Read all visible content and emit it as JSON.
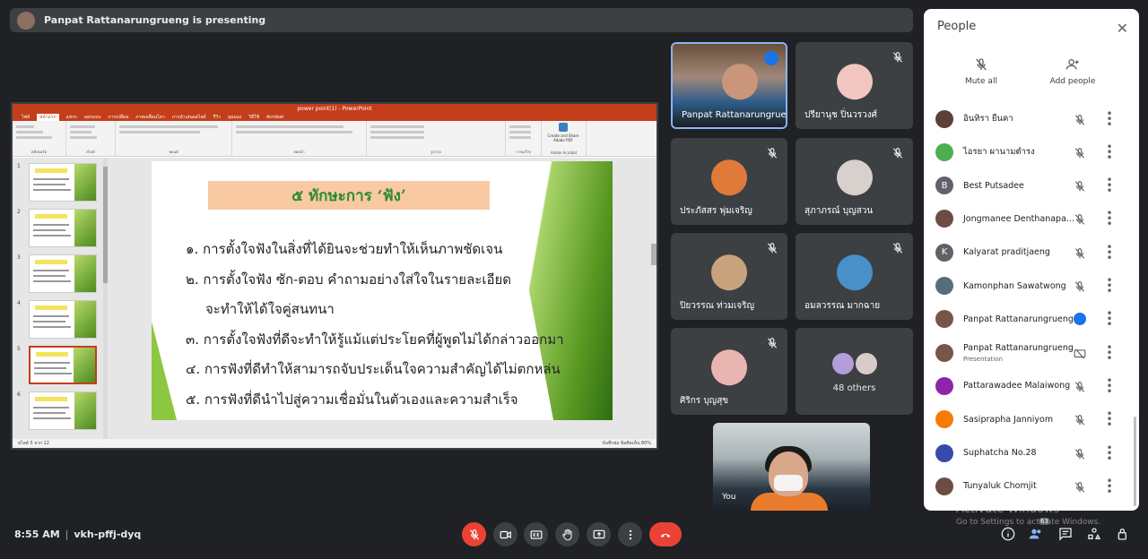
{
  "banner": {
    "text": "Panpat Rattanarungrueng is presenting"
  },
  "ppt": {
    "window_title": "power point(1) - PowerPoint",
    "tabs": [
      "ไฟล์",
      "หน้าแรก",
      "แทรก",
      "ออกแบบ",
      "การเปลี่ยน",
      "ภาพเคลื่อนไหว",
      "การนำเสนอสไลด์",
      "รีวิว",
      "มุมมอง",
      "วิธีใช้",
      "Acrobat"
    ],
    "ribbon_groups": [
      "คลิปบอร์ด",
      "สไลด์",
      "ฟอนต์",
      "ย่อหน้า",
      "รูปวาด",
      "การแก้ไข",
      "Adobe Acrobat"
    ],
    "adobe_button": "Create and Share Adobe PDF",
    "thumbnails": [
      "1",
      "2",
      "3",
      "4",
      "5",
      "6"
    ],
    "selected_slide": 5,
    "status_left": "สไลด์ 5 จาก 12",
    "status_right": "บันทึกย่อ   ข้อคิดเห็น   80%",
    "zoom_percent": 80,
    "slide": {
      "title": "๕ ทักษะการ ‘ฟัง’",
      "lines": [
        "๑. การตั้งใจฟังในสิ่งที่ได้ยินจะช่วยทำให้เห็นภาพชัดเจน",
        "๒. การตั้งใจฟัง ซัก-ตอบ คำถามอย่างใส่ใจในรายละเอียด",
        "จะทำให้ได้ใจคู่สนทนา",
        "๓. การตั้งใจฟังที่ดีจะทำให้รู้แม้แต่ประโยคที่ผู้พูดไม่ได้กล่าวออกมา",
        "๔. การฟังที่ดีทำให้สามารถจับประเด็นใจความสำคัญได้ไม่ตกหล่น",
        "๕. การฟังที่ดีนำไปสู่ความเชื่อมั่นในตัวเองและความสำเร็จ"
      ]
    }
  },
  "tiles": [
    {
      "name": "Panpat Rattanarungrue..."
    },
    {
      "name": "ปรียานุช ปิ่นวรวงศ์"
    },
    {
      "name": "ประภัสสร พุ่มเจริญ"
    },
    {
      "name": "สุภาภรณ์ บุญสวน"
    },
    {
      "name": "ปิยวรรณ ท่วมเจริญ"
    },
    {
      "name": "อมลวรรณ มากฉาย"
    },
    {
      "name": "ศิริกร บุญสุข"
    },
    {
      "name": "48 others"
    }
  ],
  "self_view": {
    "label": "You"
  },
  "people": {
    "title": "People",
    "mute_all": "Mute all",
    "add_people": "Add people",
    "list": [
      {
        "name": "อินทิรา ยืนคา",
        "avatar_color": "#5d4037",
        "initial": ""
      },
      {
        "name": "ไอรยา ผานามตำรง",
        "avatar_color": "#4caf50",
        "initial": ""
      },
      {
        "name": "Best Putsadee",
        "avatar_color": "#5f6368",
        "initial": "B"
      },
      {
        "name": "Jongmanee Denthanapa...",
        "avatar_color": "#6d4c41",
        "initial": ""
      },
      {
        "name": "Kalyarat praditjaeng",
        "avatar_color": "#5f6368",
        "initial": "K"
      },
      {
        "name": "Kamonphan Sawatwong",
        "avatar_color": "#546e7a",
        "initial": ""
      },
      {
        "name": "Panpat Rattanarungrueng",
        "avatar_color": "#795548",
        "initial": ""
      },
      {
        "name": "Panpat Rattanarungrueng",
        "sub": "Presentation",
        "avatar_color": "#795548",
        "initial": ""
      },
      {
        "name": "Pattarawadee Malaiwong",
        "avatar_color": "#8e24aa",
        "initial": ""
      },
      {
        "name": "Sasiprapha Janniyom",
        "avatar_color": "#f57c00",
        "initial": ""
      },
      {
        "name": "Suphatcha No.28",
        "avatar_color": "#3949ab",
        "initial": ""
      },
      {
        "name": "Tunyaluk Chomjit",
        "avatar_color": "#6d4c41",
        "initial": ""
      }
    ]
  },
  "watermark": {
    "line1": "Activate Windows",
    "line2": "Go to Settings to activate Windows."
  },
  "bottom": {
    "time": "8:55 AM",
    "meeting_code": "vkh-pffj-dyq",
    "people_count": "63"
  },
  "colors": {
    "accent": "#1a73e8",
    "danger": "#ea4335",
    "ppt_brand": "#c43e1c",
    "bg": "#202124"
  }
}
